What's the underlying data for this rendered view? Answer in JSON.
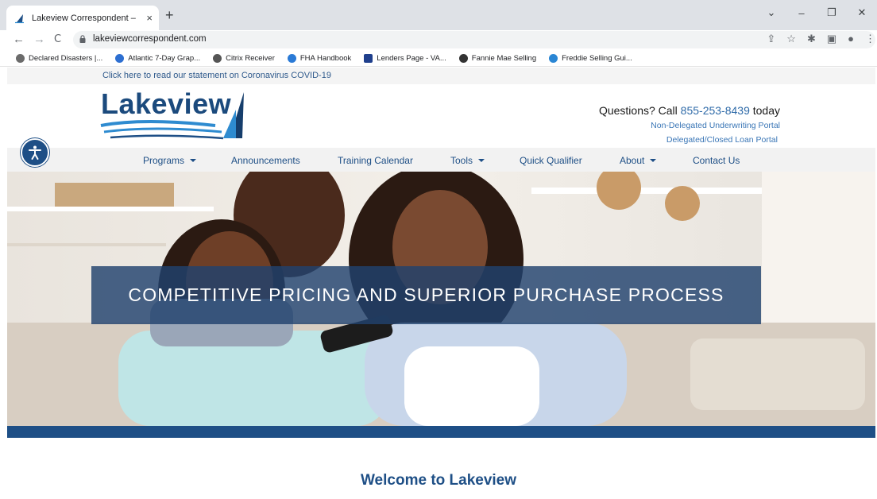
{
  "browser": {
    "tab_title": "Lakeview Correspondent – Lakeview",
    "tab_close": "×",
    "new_tab": "+",
    "url": "lakeviewcorrespondent.com",
    "window_controls": [
      "⌄",
      "–",
      "❐",
      "✕"
    ],
    "nav": {
      "back": "←",
      "forward": "→",
      "reload": "C"
    }
  },
  "bookmarks": [
    {
      "label": "Declared Disasters |...",
      "icon": "fema-icon",
      "color": "#6b6b6b"
    },
    {
      "label": "Atlantic 7-Day Grap...",
      "icon": "noaa-icon",
      "color": "#2d6fd1"
    },
    {
      "label": "Citrix Receiver",
      "icon": "citrix-icon",
      "color": "#555555"
    },
    {
      "label": "FHA Handbook",
      "icon": "hud-icon",
      "color": "#2a7ad6"
    },
    {
      "label": "Lenders Page - VA...",
      "icon": "va-icon",
      "color": "#1f3f8c"
    },
    {
      "label": "Fannie Mae Selling",
      "icon": "globe-icon",
      "color": "#333333"
    },
    {
      "label": "Freddie Selling Gui...",
      "icon": "freddie-icon",
      "color": "#2a86d4"
    }
  ],
  "site": {
    "covid_link": "Click here to read our statement on Coronavirus COVID-19",
    "logo_text": "Lakeview",
    "call_prefix": "Questions? Call ",
    "phone": "855-253-8439",
    "call_suffix": " today",
    "portal_non_delegated": "Non-Delegated Underwriting Portal",
    "portal_delegated": "Delegated/Closed Loan Portal",
    "nav": {
      "programs": "Programs",
      "announcements": "Announcements",
      "training_calendar": "Training Calendar",
      "tools": "Tools",
      "quick_qualifier": "Quick Qualifier",
      "about": "About",
      "contact": "Contact Us"
    },
    "hero_text": "COMPETITIVE PRICING AND SUPERIOR PURCHASE PROCESS",
    "welcome": "Welcome to Lakeview",
    "colors": {
      "brand_blue": "#1e4f86",
      "link_blue": "#3a76b6"
    }
  }
}
